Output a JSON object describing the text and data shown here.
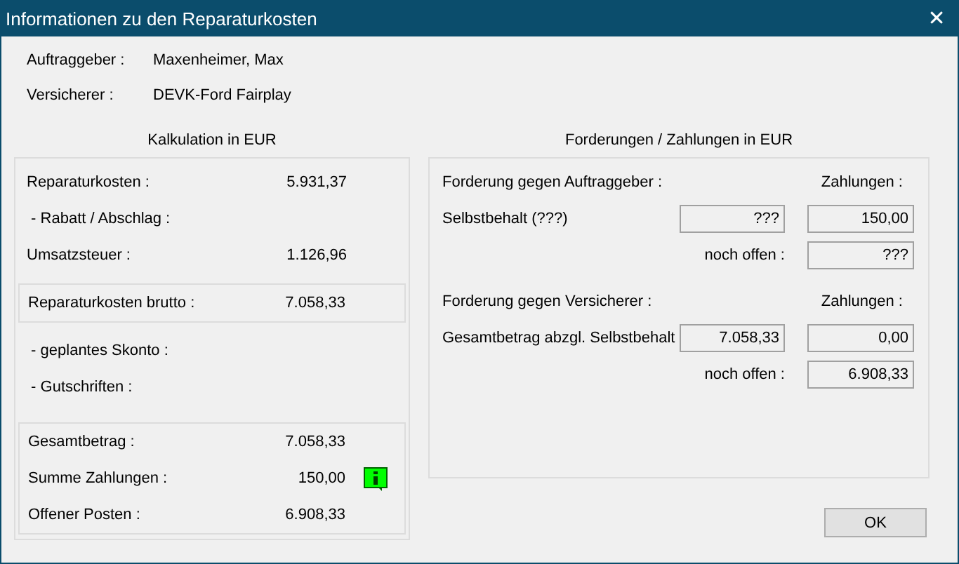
{
  "window": {
    "title": "Informationen zu den Reparaturkosten",
    "close": "✕"
  },
  "header": [
    {
      "label": "Auftraggeber :",
      "value": "Maxenheimer, Max"
    },
    {
      "label": "Versicherer :",
      "value": "DEVK-Ford Fairplay"
    }
  ],
  "calculation": {
    "title": "Kalkulation in EUR",
    "sections": [
      {
        "boxed": false,
        "rows": [
          {
            "label": "Reparaturkosten :",
            "value": "5.931,37",
            "info_icon": false
          },
          {
            "label": " - Rabatt / Abschlag :",
            "info_icon": false
          },
          {
            "label": "Umsatzsteuer :",
            "value": "1.126,96",
            "info_icon": false
          }
        ]
      },
      {
        "boxed": true,
        "rows": [
          {
            "label": "Reparaturkosten brutto :",
            "value": "7.058,33",
            "info_icon": false
          }
        ]
      },
      {
        "boxed": false,
        "rows": [
          {
            "label": " - geplantes Skonto :",
            "info_icon": false
          },
          {
            "label": " - Gutschriften :",
            "info_icon": false
          }
        ]
      },
      {
        "boxed": true,
        "rows": [
          {
            "label": "Gesamtbetrag :",
            "value": "7.058,33",
            "info_icon": false
          },
          {
            "label": "Summe Zahlungen :",
            "value": "150,00",
            "info_icon": true
          },
          {
            "label": "Offener Posten :",
            "value": "6.908,33",
            "info_icon": false
          }
        ]
      }
    ]
  },
  "claims": {
    "title": "Forderungen / Zahlungen in  EUR",
    "groups": [
      {
        "heading": "Forderung gegen Auftraggeber :",
        "payments_label": "Zahlungen :",
        "rows": [
          {
            "kind": "claim",
            "label": "Selbstbehalt (???)",
            "amount": "???",
            "payment": "150,00"
          },
          {
            "kind": "open",
            "label": "noch offen :",
            "payment": "???"
          }
        ]
      },
      {
        "heading": "Forderung gegen Versicherer :",
        "payments_label": "Zahlungen :",
        "rows": [
          {
            "kind": "claim",
            "label": "Gesamtbetrag abzgl. Selbstbehalt",
            "amount": "7.058,33",
            "payment": "0,00"
          },
          {
            "kind": "open",
            "label": "noch offen :",
            "payment": "6.908,33"
          }
        ]
      }
    ]
  },
  "buttons": [
    "OK"
  ]
}
